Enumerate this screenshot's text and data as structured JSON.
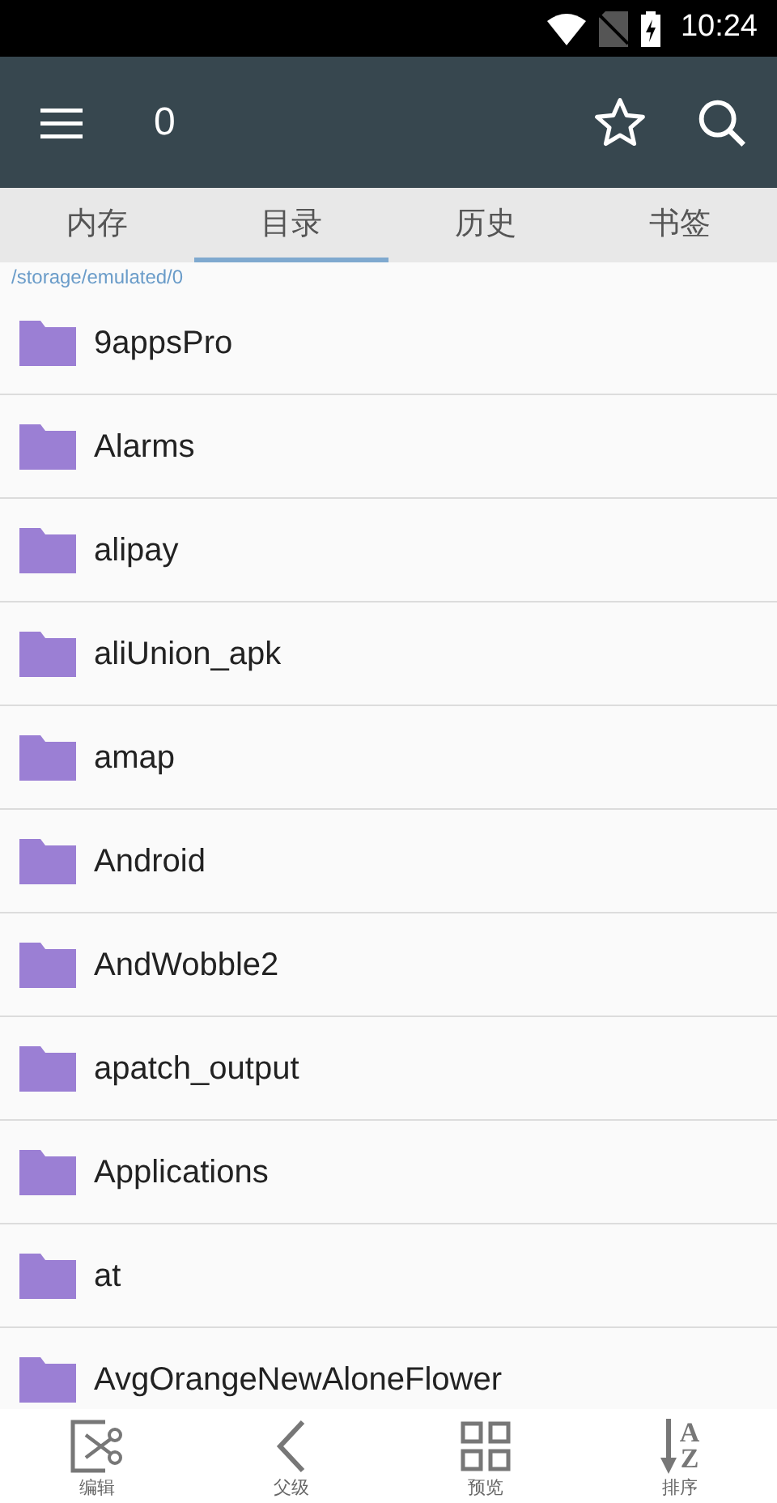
{
  "status_bar": {
    "time": "10:24"
  },
  "toolbar": {
    "title": "0"
  },
  "tabs": [
    {
      "label": "内存",
      "selected": false
    },
    {
      "label": "目录",
      "selected": true
    },
    {
      "label": "历史",
      "selected": false
    },
    {
      "label": "书签",
      "selected": false
    }
  ],
  "path": "/storage/emulated/0",
  "folders": [
    "9appsPro",
    "Alarms",
    "alipay",
    "aliUnion_apk",
    "amap",
    "Android",
    "AndWobble2",
    "apatch_output",
    "Applications",
    "at",
    "AvgOrangeNewAloneFlower"
  ],
  "bottom_bar": [
    {
      "kind": "edit",
      "label": "编辑"
    },
    {
      "kind": "parent",
      "label": "父级"
    },
    {
      "kind": "preview",
      "label": "预览"
    },
    {
      "kind": "sort",
      "label": "排序",
      "letters": [
        "A",
        "Z"
      ]
    }
  ]
}
